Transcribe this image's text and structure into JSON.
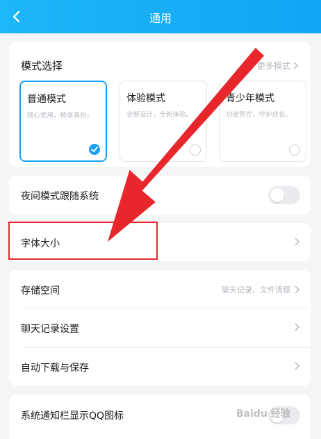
{
  "header": {
    "title": "通用"
  },
  "mode_section": {
    "title": "模式选择",
    "more": "更多模式",
    "modes": [
      {
        "name": "普通模式",
        "desc": "随心使用，畅享装扮。",
        "selected": true
      },
      {
        "name": "体验模式",
        "desc": "全新设计，全新体验。",
        "selected": false
      },
      {
        "name": "青少年模式",
        "desc": "功能管控，守护成长。",
        "selected": false
      }
    ]
  },
  "night_mode": {
    "label": "夜间模式跟随系统",
    "on": false
  },
  "font_size": {
    "label": "字体大小"
  },
  "storage": {
    "label": "存储空间",
    "hint": "聊天记录、文件清理"
  },
  "chat_settings": {
    "label": "聊天记录设置"
  },
  "auto_download": {
    "label": "自动下载与保存"
  },
  "notification_icon": {
    "label": "系统通知栏显示QQ图标"
  },
  "watermark": "Baidu 经验",
  "colors": {
    "accent": "#1aa1f4",
    "header": "#12a5f5",
    "annotation": "#e8272d"
  }
}
